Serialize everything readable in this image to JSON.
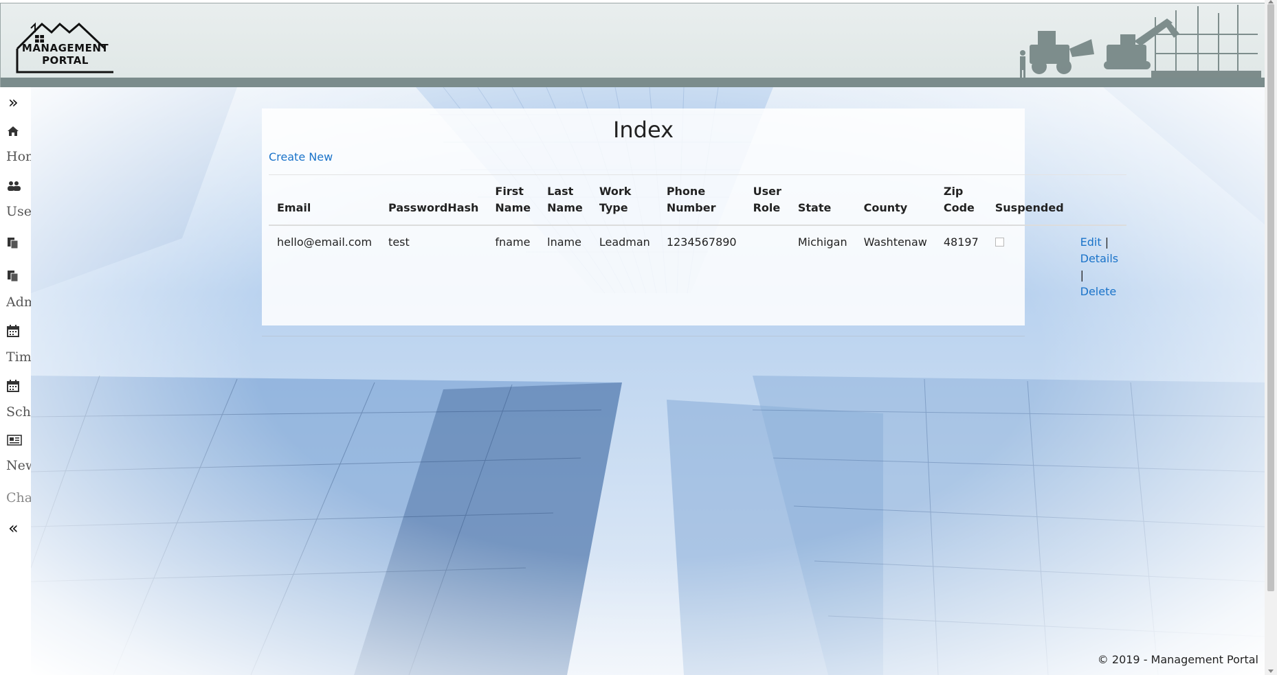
{
  "header": {
    "logo_line1": "MANAGEMENT",
    "logo_line2": "PORTAL"
  },
  "sidebar": {
    "expand_icon": "double-chevron-right-icon",
    "collapse_icon": "double-chevron-left-icon",
    "items": [
      {
        "icon": "home-icon",
        "label": "Home"
      },
      {
        "icon": "users-icon",
        "label": "Users"
      },
      {
        "icon": "files-icon",
        "label": ""
      },
      {
        "icon": "files-icon",
        "label": "Admin"
      },
      {
        "icon": "calendar-icon",
        "label": "Time"
      },
      {
        "icon": "calendar-icon",
        "label": "Schedule"
      },
      {
        "icon": "newspaper-icon",
        "label": "News"
      }
    ],
    "chat_label": "Chat"
  },
  "main": {
    "title": "Index",
    "create_new": "Create New",
    "columns": [
      "Email",
      "PasswordHash",
      "First Name",
      "Last Name",
      "Work Type",
      "Phone Number",
      "User Role",
      "State",
      "County",
      "Zip Code",
      "Suspended",
      ""
    ],
    "rows": [
      {
        "email": "hello@email.com",
        "password_hash": "test",
        "first_name": "fname",
        "last_name": "lname",
        "work_type": "Leadman",
        "phone": "1234567890",
        "user_role": "",
        "state": "Michigan",
        "county": "Washtenaw",
        "zip": "48197",
        "suspended": false,
        "actions": {
          "edit": "Edit",
          "details": "Details",
          "delete": "Delete",
          "separator": "|"
        }
      }
    ]
  },
  "footer": {
    "text": "© 2019 - Management Portal"
  }
}
